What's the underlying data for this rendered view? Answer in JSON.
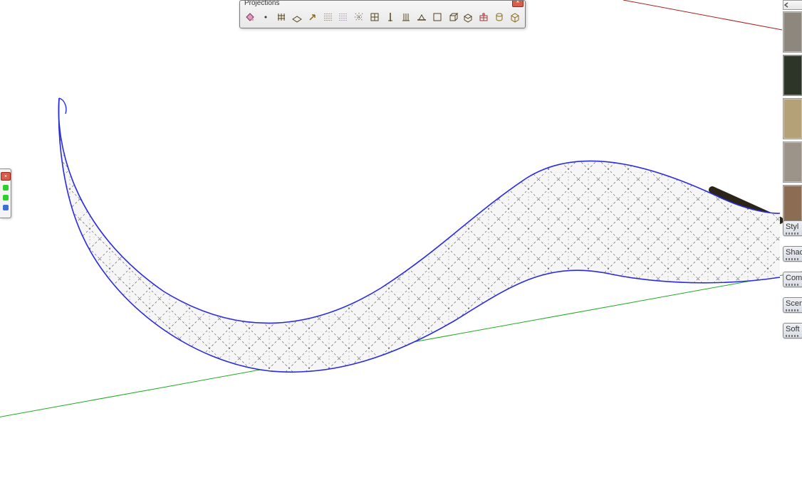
{
  "toolbar": {
    "title": "Projections",
    "close_glyph": "×",
    "buttons": [
      {
        "name": "paint-bucket-icon"
      },
      {
        "name": "point-icon"
      },
      {
        "name": "grid-small-icon"
      },
      {
        "name": "plane-xz-icon"
      },
      {
        "name": "arrow-up-right-icon"
      },
      {
        "name": "grid-dashed-icon"
      },
      {
        "name": "grid-dashed-2-icon"
      },
      {
        "name": "asterisk-icon"
      },
      {
        "name": "grid-icon"
      },
      {
        "name": "vertical-icon"
      },
      {
        "name": "vertical-align-icon"
      },
      {
        "name": "base-line-icon"
      },
      {
        "name": "square-icon"
      },
      {
        "name": "cube-icon"
      },
      {
        "name": "cube-slanted-icon"
      },
      {
        "name": "gift-box-icon"
      },
      {
        "name": "cylinder-icon"
      },
      {
        "name": "box-icon"
      }
    ]
  },
  "left_fragment": {
    "close_glyph": "×",
    "dots": [
      "green",
      "green",
      "blue"
    ]
  },
  "swatches": [
    {
      "name": "swatch-stone-light",
      "color": "#8e877d"
    },
    {
      "name": "swatch-dark-green",
      "color": "#2c3528"
    },
    {
      "name": "swatch-sand",
      "color": "#b4a178"
    },
    {
      "name": "swatch-grey-streak",
      "color": "#9c9489"
    },
    {
      "name": "swatch-rust",
      "color": "#8c6d54"
    }
  ],
  "tray_tabs": [
    {
      "label": "Styl"
    },
    {
      "label": "Shad"
    },
    {
      "label": "Com"
    },
    {
      "label": "Scen"
    },
    {
      "label": "Soft"
    }
  ],
  "colors": {
    "axis_green": "#1eaa1e",
    "axis_red": "#aa1e1e",
    "edge_blue": "#2a2ae0",
    "surface": "#f6f6f6"
  }
}
